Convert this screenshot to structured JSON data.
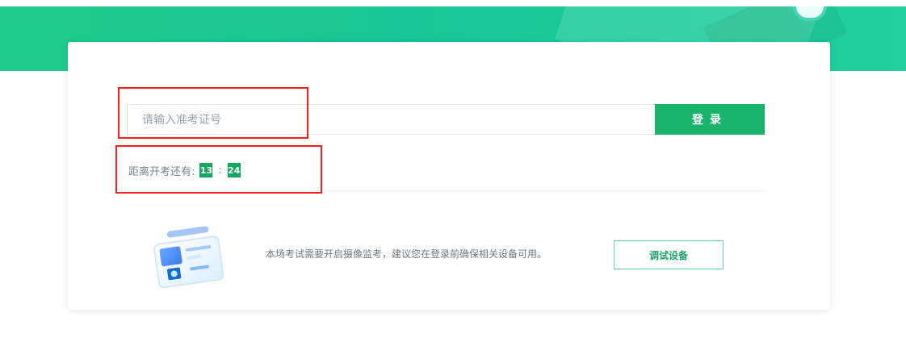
{
  "page": {
    "ticket_placeholder": "请输入准考证号",
    "login_label": "登录",
    "countdown_label": "距离开考还有:",
    "countdown_minutes": "13",
    "countdown_separator": ":",
    "countdown_seconds": "24",
    "device_notice": "本场考试需要开启摄像监考，建议您在登录前确保相关设备可用。",
    "test_device_label": "调试设备"
  },
  "colors": {
    "banner": "#1fcb8b",
    "primary_button": "#19b46c",
    "timer": "#16a75f",
    "highlight_frame": "#ff1f1f"
  },
  "icons": {
    "illustration": "camera-test-illustration"
  }
}
